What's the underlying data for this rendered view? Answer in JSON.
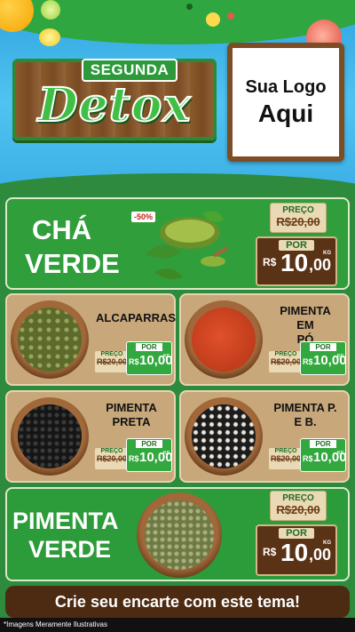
{
  "header": {
    "sign_subtitle": "SEGUNDA",
    "sign_title": "Detox",
    "logo_line1": "Sua Logo",
    "logo_line2": "Aqui"
  },
  "products": {
    "cha_verde": {
      "name_line1": "CHÁ",
      "name_line2": "VERDE",
      "badge": "-50%",
      "preco_label": "PREÇO",
      "old_price": "R$20,00",
      "por_label": "POR",
      "currency": "R$",
      "price_int": "10",
      "price_dec": ",00",
      "unit": "KG"
    },
    "alcaparras": {
      "name": "ALCAPARRAS",
      "preco_label": "PREÇO",
      "old_price": "R$20,00",
      "por_label": "POR",
      "currency": "R$",
      "price": "10,00",
      "unit": "KG"
    },
    "pimenta_po": {
      "name_line1": "PIMENTA EM",
      "name_line2": "PÓ",
      "preco_label": "PREÇO",
      "old_price": "R$20,00",
      "por_label": "POR",
      "currency": "R$",
      "price": "10,00",
      "unit": "KG"
    },
    "pimenta_preta": {
      "name_line1": "PIMENTA",
      "name_line2": "PRETA",
      "preco_label": "PREÇO",
      "old_price": "R$20,00",
      "por_label": "POR",
      "currency": "R$",
      "price": "10,00",
      "unit": "KG"
    },
    "pimenta_pb": {
      "name_line1": "PIMENTA P.",
      "name_line2": "E B.",
      "preco_label": "PREÇO",
      "old_price": "R$20,00",
      "por_label": "POR",
      "currency": "R$",
      "price": "10,00",
      "unit": "KG"
    },
    "pimenta_verde": {
      "name_line1": "PIMENTA",
      "name_line2": "VERDE",
      "preco_label": "PREÇO",
      "old_price": "R$20,00",
      "por_label": "POR",
      "currency": "R$",
      "price_int": "10",
      "price_dec": ",00",
      "unit": "KG"
    }
  },
  "footer": {
    "cta": "Crie seu encarte com este tema!",
    "note": "*Imagens Meramente Ilustrativas"
  },
  "colors": {
    "green": "#2f9e3b",
    "tan": "#c8a77a",
    "wood": "#5a3317",
    "sky": "#4fc3f0"
  }
}
